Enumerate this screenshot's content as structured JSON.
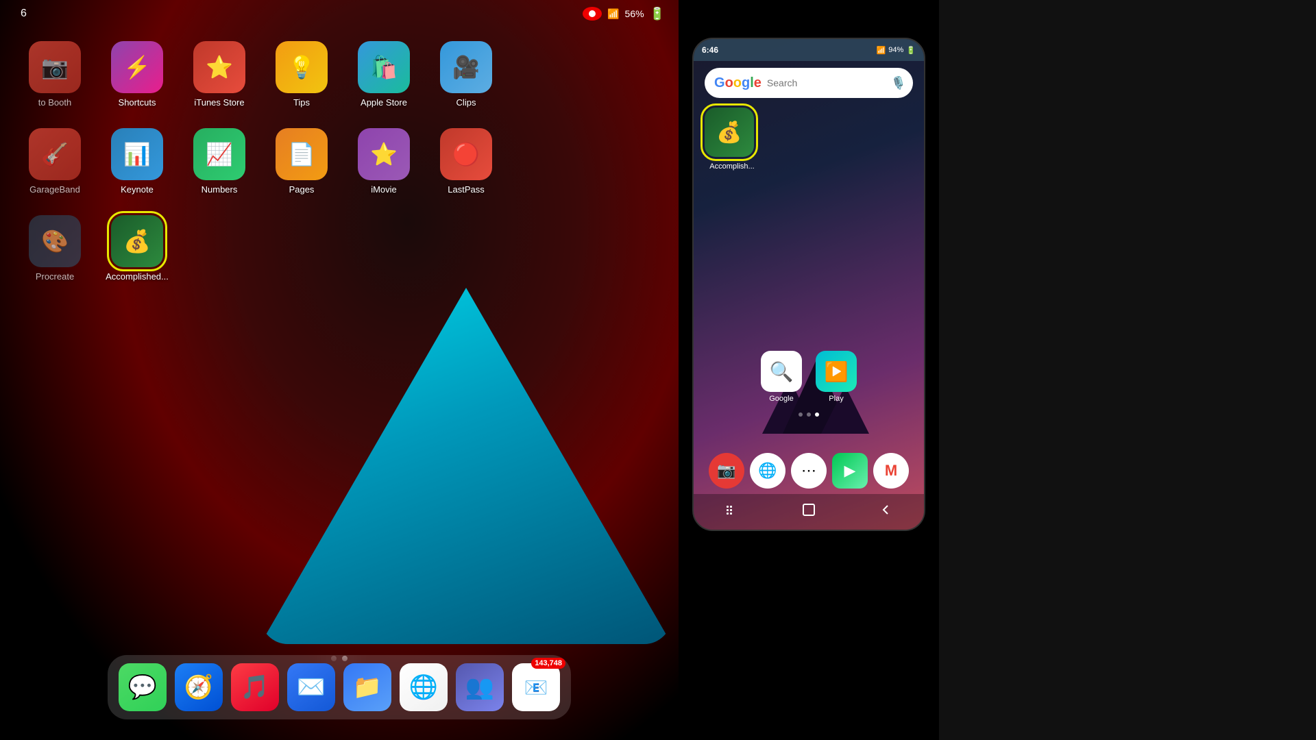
{
  "ipad": {
    "status": {
      "time": "6",
      "battery": "56%",
      "wifi": "📶"
    },
    "apps_row1": [
      {
        "id": "photo-booth",
        "label": "to Booth",
        "emoji": "📷",
        "bg": "photobooth-bg",
        "partial": true
      },
      {
        "id": "shortcuts",
        "label": "Shortcuts",
        "emoji": "⚡",
        "bg": "shortcuts-bg"
      },
      {
        "id": "itunes-store",
        "label": "iTunes Store",
        "emoji": "⭐",
        "bg": "itunes-bg"
      },
      {
        "id": "tips",
        "label": "Tips",
        "emoji": "💡",
        "bg": "tips-bg"
      },
      {
        "id": "apple-store",
        "label": "Apple Store",
        "emoji": "🛍️",
        "bg": "applestore-bg"
      },
      {
        "id": "clips",
        "label": "Clips",
        "emoji": "🎥",
        "bg": "clips-bg"
      }
    ],
    "apps_row2": [
      {
        "id": "garageband",
        "label": "GarageBand",
        "emoji": "🎸",
        "bg": "garageband-bg",
        "partial": true
      },
      {
        "id": "keynote",
        "label": "Keynote",
        "emoji": "📊",
        "bg": "keynote-bg"
      },
      {
        "id": "numbers",
        "label": "Numbers",
        "emoji": "📈",
        "bg": "numbers-bg"
      },
      {
        "id": "pages",
        "label": "Pages",
        "emoji": "📄",
        "bg": "pages-bg"
      },
      {
        "id": "imovie",
        "label": "iMovie",
        "emoji": "⭐",
        "bg": "imovie-bg"
      },
      {
        "id": "lastpass",
        "label": "LastPass",
        "emoji": "🔴",
        "bg": "lastpass-bg"
      }
    ],
    "apps_row3": [
      {
        "id": "procreate",
        "label": "Procreate",
        "emoji": "🎨",
        "bg": "procreate-bg",
        "partial": true
      },
      {
        "id": "accomplished",
        "label": "Accomplished...",
        "emoji": "💰",
        "bg": "accomplished-bg",
        "highlighted": true
      }
    ],
    "dock": [
      {
        "id": "messages",
        "emoji": "💬",
        "bg": "icon-messages"
      },
      {
        "id": "safari",
        "emoji": "🧭",
        "bg": "icon-safari"
      },
      {
        "id": "music",
        "emoji": "🎵",
        "bg": "icon-music"
      },
      {
        "id": "mail",
        "emoji": "✉️",
        "bg": "icon-mail"
      },
      {
        "id": "files",
        "emoji": "📁",
        "bg": "icon-files"
      },
      {
        "id": "chrome",
        "emoji": "🌐",
        "bg": "icon-chrome"
      },
      {
        "id": "teams",
        "emoji": "👥",
        "bg": "icon-teams"
      },
      {
        "id": "gmail",
        "emoji": "📧",
        "bg": "icon-gmail-dock",
        "badge": "143,748"
      }
    ]
  },
  "android": {
    "status": {
      "time": "6:46",
      "battery": "94%"
    },
    "search_placeholder": "Search",
    "accomplished_label": "Accomplish...",
    "apps": [
      {
        "id": "google",
        "label": "Google",
        "emoji": "🔍",
        "bg": "android-google-bg"
      },
      {
        "id": "play",
        "label": "Play",
        "emoji": "▶️",
        "bg": "android-play-bg"
      }
    ],
    "dock": [
      {
        "id": "camera",
        "emoji": "📷",
        "bg": "android-red-cam"
      },
      {
        "id": "chrome",
        "emoji": "🌐",
        "bg": "android-chrome"
      },
      {
        "id": "app-drawer",
        "emoji": "⋯",
        "bg": "android-grid"
      },
      {
        "id": "play-store",
        "emoji": "▶",
        "bg": "android-play"
      },
      {
        "id": "gmail",
        "emoji": "M",
        "bg": "android-gmail"
      }
    ],
    "nav": [
      {
        "id": "menu",
        "symbol": "⋮⋮⋮"
      },
      {
        "id": "home",
        "symbol": "⬜"
      },
      {
        "id": "back",
        "symbol": "◁"
      }
    ]
  }
}
